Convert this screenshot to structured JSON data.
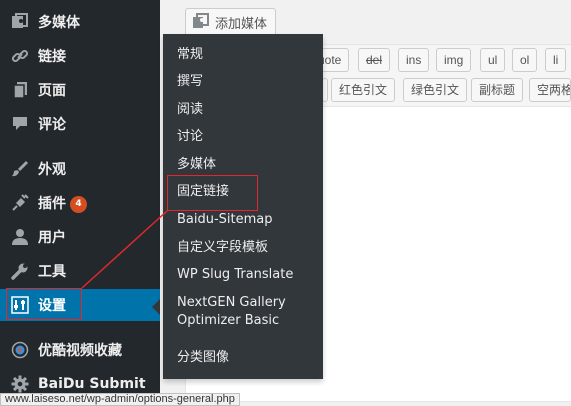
{
  "sidebar": {
    "items": [
      {
        "label": "多媒体",
        "icon": "media-icon"
      },
      {
        "label": "链接",
        "icon": "link-icon"
      },
      {
        "label": "页面",
        "icon": "page-icon"
      },
      {
        "label": "评论",
        "icon": "comment-icon"
      },
      {
        "label": "外观",
        "icon": "brush-icon"
      },
      {
        "label": "插件",
        "icon": "plugin-icon",
        "badge": "4"
      },
      {
        "label": "用户",
        "icon": "user-icon"
      },
      {
        "label": "工具",
        "icon": "wrench-icon"
      },
      {
        "label": "设置",
        "icon": "settings-icon",
        "current": true
      },
      {
        "label": "优酷视频收藏",
        "icon": "video-icon"
      },
      {
        "label": "BaiDu Submit",
        "icon": "gear-icon"
      }
    ]
  },
  "editor": {
    "add_media_label": "添加媒体",
    "quicktags_row1": [
      "uote",
      "del",
      "ins",
      "img",
      "ul",
      "ol",
      "li"
    ],
    "quicktags_row2": [
      "红色引文",
      "绿色引文",
      "副标题",
      "空两格"
    ]
  },
  "flyout": {
    "items": [
      "常规",
      "撰写",
      "阅读",
      "讨论",
      "多媒体",
      "固定链接",
      "Baidu-Sitemap",
      "自定义字段模板",
      "WP Slug Translate",
      "NextGEN Gallery Optimizer Basic",
      "分类图像"
    ]
  },
  "annotation_color": "#e0282c",
  "status_url": "www.laiseso.net/wp-admin/options-general.php"
}
